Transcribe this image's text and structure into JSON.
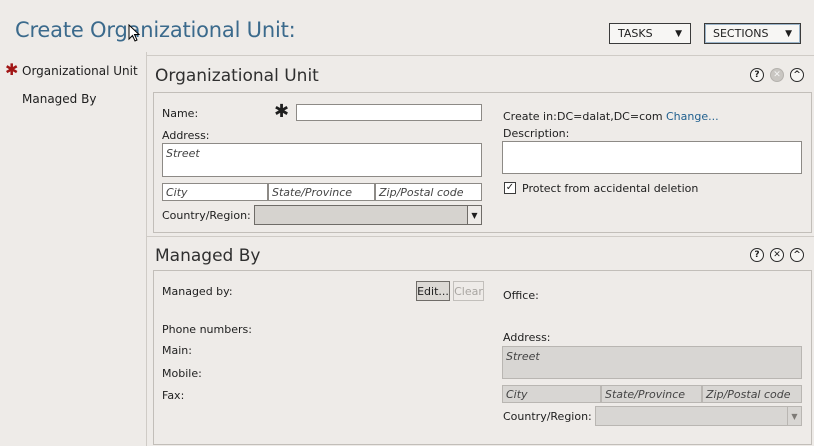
{
  "header": {
    "title": "Create Organizational Unit:",
    "tasks_label": "TASKS",
    "sections_label": "SECTIONS"
  },
  "sidebar": {
    "items": [
      {
        "label": "Organizational Unit",
        "required": true
      },
      {
        "label": "Managed By",
        "required": false
      }
    ]
  },
  "ou_section": {
    "title": "Organizational Unit",
    "name_label": "Name:",
    "name_value": "",
    "address_label": "Address:",
    "street_placeholder": "Street",
    "city_placeholder": "City",
    "state_placeholder": "State/Province",
    "zip_placeholder": "Zip/Postal code",
    "country_label": "Country/Region:",
    "country_value": "",
    "create_in_label": "Create in:",
    "create_in_value": "DC=dalat,DC=com",
    "change_link": "Change...",
    "description_label": "Description:",
    "description_value": "",
    "protect_label": "Protect from accidental deletion",
    "protect_checked": true
  },
  "managed_section": {
    "title": "Managed By",
    "managed_by_label": "Managed by:",
    "edit_label": "Edit...",
    "clear_label": "Clear",
    "phone_label": "Phone numbers:",
    "main_label": "Main:",
    "mobile_label": "Mobile:",
    "fax_label": "Fax:",
    "office_label": "Office:",
    "address_label": "Address:",
    "street_placeholder": "Street",
    "city_placeholder": "City",
    "state_placeholder": "State/Province",
    "zip_placeholder": "Zip/Postal code",
    "country_label": "Country/Region:",
    "country_value": ""
  },
  "icons": {
    "help": "?",
    "close": "✕",
    "collapse": "^",
    "required": "✱",
    "dropdown": "▼",
    "check": "✓"
  },
  "colors": {
    "title": "#3b6a8c",
    "required": "#a11616",
    "link": "#1f5f8e",
    "background": "#eeebe8"
  }
}
